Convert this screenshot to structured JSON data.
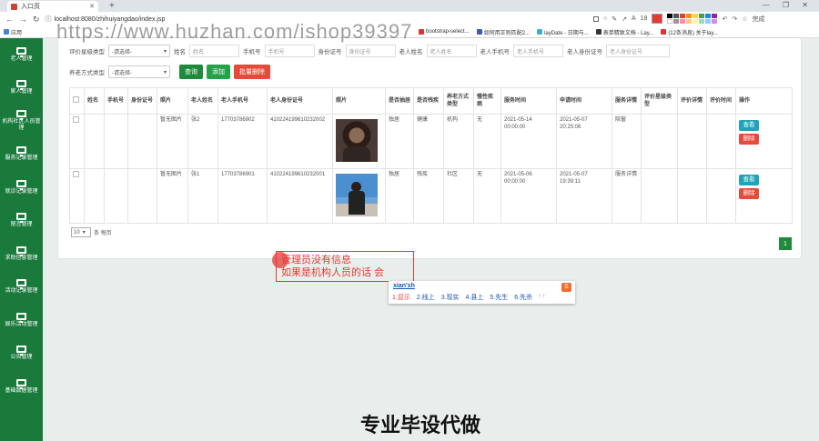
{
  "browser": {
    "tab_title": "入口页",
    "new_tab": "+",
    "window_controls": "— ❐ ✕",
    "url": "localhost:8080/zhihuiyangdao/index.jsp",
    "bookmarks": [
      "应用",
      "bootstrap-select...",
      "如何用正则匹配2...",
      "layDate - 日期与...",
      "表单精致文档 - Lay...",
      "(12条消息) 关于lay..."
    ],
    "zoom_value": "18",
    "right_label": "完成"
  },
  "watermark": "https://www.huzhan.com/ishop39397",
  "sidebar": {
    "items": [
      "老人管理",
      "家人管理",
      "机构社区人员管理",
      "服务记录管理",
      "就诊记录管理",
      "留言管理",
      "求助信息管理",
      "活动记录管理",
      "娱乐活动管理",
      "公告管理",
      "基础数据管理"
    ]
  },
  "filters": {
    "row1": {
      "eval_label": "评价星级类型",
      "eval_value": "-请选择-",
      "name_label": "姓名",
      "name_placeholder": "姓名",
      "phone_label": "手机号",
      "phone_placeholder": "手机号",
      "id_label": "身份证号",
      "id_placeholder": "身份证号",
      "elder_name_label": "老人姓名",
      "elder_name_placeholder": "老人姓名",
      "elder_phone_label": "老人手机号",
      "elder_phone_placeholder": "老人手机号",
      "elder_id_label": "老人身份证号",
      "elder_id_placeholder": "老人身份证号"
    },
    "row2": {
      "care_label": "养老方式类型",
      "care_value": "-请选择-",
      "search_btn": "查询",
      "add_btn": "添加",
      "batch_delete_btn": "批量删除"
    }
  },
  "table": {
    "headers": [
      "",
      "姓名",
      "手机号",
      "身份证号",
      "照片",
      "老人姓名",
      "老人手机号",
      "老人身份证号",
      "照片",
      "是否抽居",
      "是否残疾",
      "养老方式类型",
      "慢性疾病",
      "服务时间",
      "申请时间",
      "服务详情",
      "评价星级类型",
      "评价详情",
      "评价时间",
      "操作"
    ],
    "rows": [
      {
        "name": "",
        "phone": "",
        "id": "",
        "photo": "暂无图片",
        "elder_name": "张2",
        "elder_phone": "17703786902",
        "elder_id": "410224199610232002",
        "alone": "独居",
        "disabled": "健康",
        "care": "机构",
        "chronic": "无",
        "service_time": "2021-05-14 00:00:00",
        "apply_time": "2021-05-07 20:25:06",
        "detail": "陪窗",
        "eval_type": "",
        "eval_detail": "",
        "eval_time": "",
        "view": "查看",
        "delete": "删除"
      },
      {
        "name": "",
        "phone": "",
        "id": "",
        "photo": "暂无图片",
        "elder_name": "张1",
        "elder_phone": "17703786901",
        "elder_id": "410224199610232001",
        "alone": "独居",
        "disabled": "残疾",
        "care": "社区",
        "chronic": "无",
        "service_time": "2021-05-06 00:00:00",
        "apply_time": "2021-05-07 19:39:11",
        "detail": "服务详情",
        "eval_type": "",
        "eval_detail": "",
        "eval_time": "",
        "view": "查看",
        "delete": "删除"
      }
    ]
  },
  "pager": {
    "per_page": "10",
    "per_page_label": "条 每页",
    "page": "1"
  },
  "note": {
    "line1": "管理员没有信息",
    "line2": "如果是机构人员的话 会"
  },
  "ime": {
    "composition": "xian'sh",
    "candidates": [
      "1.显示",
      "2.线上",
      "3.现实",
      "4.县上",
      "5.先生",
      "6.先杀"
    ],
    "arrows": "‹ ›",
    "logo": "S"
  },
  "footer": "专业毕设代做",
  "colors": {
    "sidebar": "#1a7a3c",
    "primary_green": "#1e8a3a",
    "danger": "#e64a3b",
    "info": "#1fa3b8",
    "note_red": "#e53935"
  }
}
